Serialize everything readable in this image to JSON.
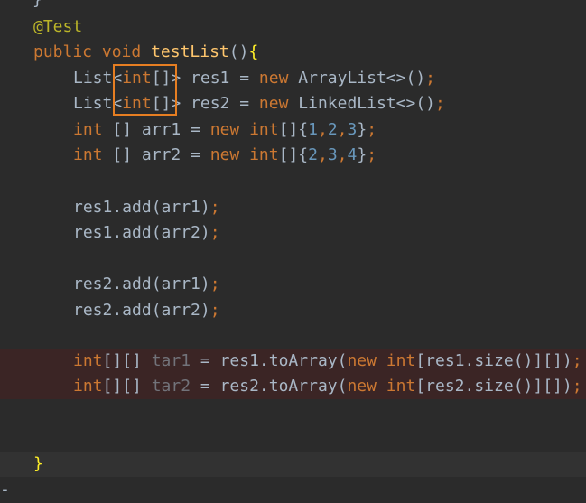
{
  "editor": {
    "lines": [
      {
        "tokens": [
          {
            "t": "}",
            "c": "plain"
          }
        ]
      },
      {
        "tokens": [
          {
            "t": "@Test",
            "c": "ann"
          }
        ]
      },
      {
        "tokens": [
          {
            "t": "public",
            "c": "kw"
          },
          {
            "t": " ",
            "c": "plain"
          },
          {
            "t": "void",
            "c": "kw"
          },
          {
            "t": " ",
            "c": "plain"
          },
          {
            "t": "testList",
            "c": "fn"
          },
          {
            "t": "()",
            "c": "plain"
          },
          {
            "t": "{",
            "c": "brace-match"
          }
        ]
      },
      {
        "tokens": [
          {
            "t": "List<",
            "c": "plain"
          },
          {
            "t": "int",
            "c": "kw"
          },
          {
            "t": "[]> res1 = ",
            "c": "plain"
          },
          {
            "t": "new",
            "c": "kw"
          },
          {
            "t": " ArrayList<>()",
            "c": "plain"
          },
          {
            "t": ";",
            "c": "kw"
          }
        ]
      },
      {
        "tokens": [
          {
            "t": "List<",
            "c": "plain"
          },
          {
            "t": "int",
            "c": "kw"
          },
          {
            "t": "[]> res2 = ",
            "c": "plain"
          },
          {
            "t": "new",
            "c": "kw"
          },
          {
            "t": " LinkedList<>()",
            "c": "plain"
          },
          {
            "t": ";",
            "c": "kw"
          }
        ]
      },
      {
        "tokens": [
          {
            "t": "int",
            "c": "kw"
          },
          {
            "t": " [] arr1 = ",
            "c": "plain"
          },
          {
            "t": "new",
            "c": "kw"
          },
          {
            "t": " ",
            "c": "plain"
          },
          {
            "t": "int",
            "c": "kw"
          },
          {
            "t": "[]{",
            "c": "plain"
          },
          {
            "t": "1",
            "c": "num"
          },
          {
            "t": ",",
            "c": "kw"
          },
          {
            "t": "2",
            "c": "num"
          },
          {
            "t": ",",
            "c": "kw"
          },
          {
            "t": "3",
            "c": "num"
          },
          {
            "t": "}",
            "c": "plain"
          },
          {
            "t": ";",
            "c": "kw"
          }
        ]
      },
      {
        "tokens": [
          {
            "t": "int",
            "c": "kw"
          },
          {
            "t": " [] arr2 = ",
            "c": "plain"
          },
          {
            "t": "new",
            "c": "kw"
          },
          {
            "t": " ",
            "c": "plain"
          },
          {
            "t": "int",
            "c": "kw"
          },
          {
            "t": "[]{",
            "c": "plain"
          },
          {
            "t": "2",
            "c": "num"
          },
          {
            "t": ",",
            "c": "kw"
          },
          {
            "t": "3",
            "c": "num"
          },
          {
            "t": ",",
            "c": "kw"
          },
          {
            "t": "4",
            "c": "num"
          },
          {
            "t": "}",
            "c": "plain"
          },
          {
            "t": ";",
            "c": "kw"
          }
        ]
      },
      {
        "tokens": []
      },
      {
        "tokens": [
          {
            "t": "res1.add(arr1)",
            "c": "plain"
          },
          {
            "t": ";",
            "c": "kw"
          }
        ]
      },
      {
        "tokens": [
          {
            "t": "res1.add(arr2)",
            "c": "plain"
          },
          {
            "t": ";",
            "c": "kw"
          }
        ]
      },
      {
        "tokens": []
      },
      {
        "tokens": [
          {
            "t": "res2.add(arr1)",
            "c": "plain"
          },
          {
            "t": ";",
            "c": "kw"
          }
        ]
      },
      {
        "tokens": [
          {
            "t": "res2.add(arr2)",
            "c": "plain"
          },
          {
            "t": ";",
            "c": "kw"
          }
        ]
      },
      {
        "tokens": []
      },
      {
        "tokens": [
          {
            "t": "int",
            "c": "kw"
          },
          {
            "t": "[][] ",
            "c": "plain"
          },
          {
            "t": "tar1",
            "c": "unused"
          },
          {
            "t": " = res1.toArray(",
            "c": "plain"
          },
          {
            "t": "new",
            "c": "kw"
          },
          {
            "t": " ",
            "c": "plain"
          },
          {
            "t": "int",
            "c": "kw"
          },
          {
            "t": "[res1.size()][])",
            "c": "plain"
          },
          {
            "t": ";",
            "c": "kw"
          }
        ]
      },
      {
        "tokens": [
          {
            "t": "int",
            "c": "kw"
          },
          {
            "t": "[][] ",
            "c": "plain"
          },
          {
            "t": "tar2",
            "c": "unused"
          },
          {
            "t": " = res2.toArray(",
            "c": "plain"
          },
          {
            "t": "new",
            "c": "kw"
          },
          {
            "t": " ",
            "c": "plain"
          },
          {
            "t": "int",
            "c": "kw"
          },
          {
            "t": "[res2.size()][])",
            "c": "plain"
          },
          {
            "t": ";",
            "c": "kw"
          }
        ]
      },
      {
        "tokens": []
      },
      {
        "tokens": []
      },
      {
        "tokens": [
          {
            "t": "}",
            "c": "brace-match"
          }
        ]
      },
      {
        "tokens": [
          {
            "t": "-",
            "c": "plain"
          }
        ]
      }
    ]
  },
  "colors": {
    "background": "#2b2b2b",
    "keyword": "#cc7832",
    "annotation": "#bbb529",
    "method": "#ffc66d",
    "number": "#6897bb",
    "unused_variable": "#72737a",
    "error_line_background": "#3b2525",
    "highlight_box": "#e67e22"
  }
}
